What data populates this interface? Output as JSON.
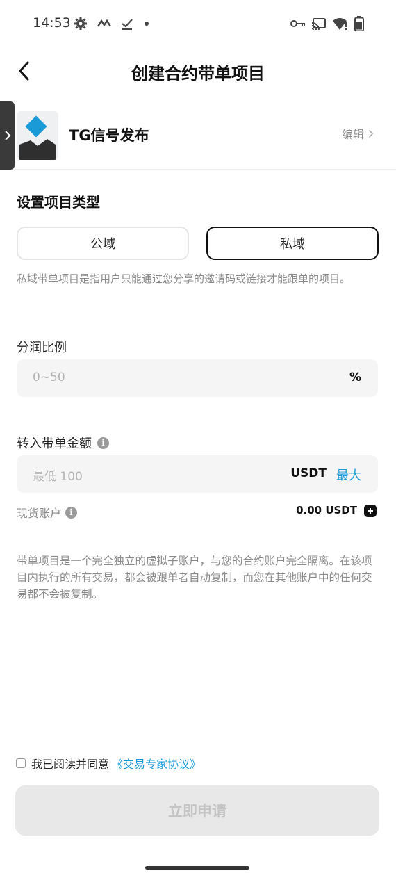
{
  "status_bar": {
    "time": "14:53",
    "left_icons": [
      "gear-icon",
      "signal-wave-icon",
      "check-icon",
      "dot-icon"
    ],
    "right_icons": [
      "key-icon",
      "cast-icon",
      "wifi-alert-icon",
      "battery-icon"
    ]
  },
  "header": {
    "title": "创建合约带单项目",
    "back_icon": "chevron-left-icon"
  },
  "project": {
    "name": "TG信号发布",
    "edit_label": "编辑",
    "accent_color": "#1a9bd7"
  },
  "project_type": {
    "section_title": "设置项目类型",
    "options": [
      {
        "label": "公域",
        "selected": false
      },
      {
        "label": "私域",
        "selected": true
      }
    ],
    "description": "私域带单项目是指用户只能通过您分享的邀请码或链接才能跟单的项目。"
  },
  "profit_share": {
    "label": "分润比例",
    "placeholder": "0~50",
    "suffix": "%"
  },
  "transfer": {
    "label": "转入带单金额",
    "placeholder": "最低 100",
    "unit": "USDT",
    "max_label": "最大"
  },
  "spot_account": {
    "label": "现货账户",
    "balance": "0.00 USDT"
  },
  "note": "带单项目是一个完全独立的虚拟子账户，与您的合约账户完全隔离。在该项目内执行的所有交易，都会被跟单者自动复制，而您在其他账户中的任何交易都不会被复制。",
  "agreement": {
    "text": "我已阅读并同意",
    "link": "《交易专家协议》",
    "checked": false
  },
  "submit": {
    "label": "立即申请",
    "enabled": false
  },
  "colors": {
    "link": "#1a9bd7",
    "disabled_button": "#e8e8e8",
    "input_bg": "#f5f5f5"
  }
}
